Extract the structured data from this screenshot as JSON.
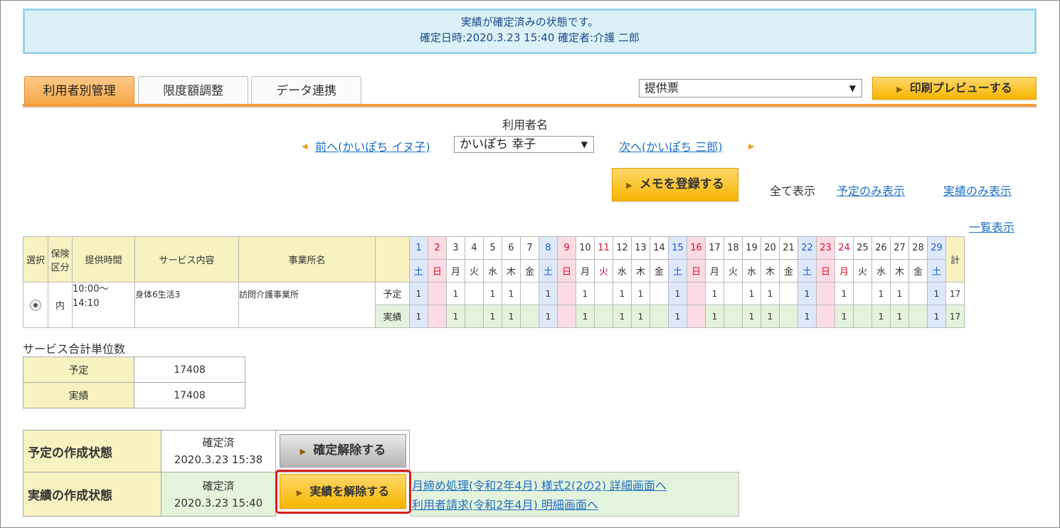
{
  "notice": {
    "line1": "実績が確定済みの状態です。",
    "line2": "確定日時:2020.3.23 15:40 確定者:介護 二郎"
  },
  "tabs": [
    "利用者別管理",
    "限度額調整",
    "データ連携"
  ],
  "report_select": {
    "value": "提供票"
  },
  "print_button": "印刷プレビューする",
  "user_nav": {
    "label": "利用者名",
    "prev": "前へ(かいぽち イヌ子)",
    "current": "かいぽち 幸子",
    "next": "次へ(かいぽち 三郎)"
  },
  "memo_button": "メモを登録する",
  "view_filters": {
    "all": "全て表示",
    "planned_only": "予定のみ表示",
    "actual_only": "実績のみ表示"
  },
  "list_view_link": "一覧表示",
  "table": {
    "headers": {
      "select": "選択",
      "insurance": "保険区分",
      "time": "提供時間",
      "service": "サービス内容",
      "office": "事業所名",
      "total": "計"
    },
    "days": [
      {
        "d": "1",
        "w": "土",
        "t": "sat"
      },
      {
        "d": "2",
        "w": "日",
        "t": "sun"
      },
      {
        "d": "3",
        "w": "月",
        "t": "wk"
      },
      {
        "d": "4",
        "w": "火",
        "t": "wk"
      },
      {
        "d": "5",
        "w": "水",
        "t": "wk"
      },
      {
        "d": "6",
        "w": "木",
        "t": "wk"
      },
      {
        "d": "7",
        "w": "金",
        "t": "wk"
      },
      {
        "d": "8",
        "w": "土",
        "t": "sat"
      },
      {
        "d": "9",
        "w": "日",
        "t": "sun"
      },
      {
        "d": "10",
        "w": "月",
        "t": "wk"
      },
      {
        "d": "11",
        "w": "火",
        "t": "hol"
      },
      {
        "d": "12",
        "w": "水",
        "t": "wk"
      },
      {
        "d": "13",
        "w": "木",
        "t": "wk"
      },
      {
        "d": "14",
        "w": "金",
        "t": "wk"
      },
      {
        "d": "15",
        "w": "土",
        "t": "sat"
      },
      {
        "d": "16",
        "w": "日",
        "t": "sun"
      },
      {
        "d": "17",
        "w": "月",
        "t": "wk"
      },
      {
        "d": "18",
        "w": "火",
        "t": "wk"
      },
      {
        "d": "19",
        "w": "水",
        "t": "wk"
      },
      {
        "d": "20",
        "w": "木",
        "t": "wk"
      },
      {
        "d": "21",
        "w": "金",
        "t": "wk"
      },
      {
        "d": "22",
        "w": "土",
        "t": "sat"
      },
      {
        "d": "23",
        "w": "日",
        "t": "sun"
      },
      {
        "d": "24",
        "w": "月",
        "t": "hol"
      },
      {
        "d": "25",
        "w": "火",
        "t": "wk"
      },
      {
        "d": "26",
        "w": "水",
        "t": "wk"
      },
      {
        "d": "27",
        "w": "木",
        "t": "wk"
      },
      {
        "d": "28",
        "w": "金",
        "t": "wk"
      },
      {
        "d": "29",
        "w": "土",
        "t": "sat"
      }
    ],
    "row": {
      "insurance": "内",
      "time": "10:00〜\n14:10",
      "service": "身体6生活3",
      "office": "訪問介護事業所",
      "planned_label": "予定",
      "actual_label": "実績",
      "planned": [
        "1",
        "",
        "1",
        "",
        "1",
        "1",
        "",
        "1",
        "",
        "1",
        "",
        "1",
        "1",
        "",
        "1",
        "",
        "1",
        "",
        "1",
        "1",
        "",
        "1",
        "",
        "1",
        "",
        "1",
        "1",
        "",
        "1"
      ],
      "actual": [
        "1",
        "",
        "1",
        "",
        "1",
        "1",
        "",
        "1",
        "",
        "1",
        "",
        "1",
        "1",
        "",
        "1",
        "",
        "1",
        "",
        "1",
        "1",
        "",
        "1",
        "",
        "1",
        "",
        "1",
        "1",
        "",
        "1"
      ],
      "planned_total": "17",
      "actual_total": "17"
    }
  },
  "summary": {
    "title": "サービス合計単位数",
    "rows": [
      {
        "label": "予定",
        "value": "17408"
      },
      {
        "label": "実績",
        "value": "17408"
      }
    ]
  },
  "status": {
    "planned_label": "予定の作成状態",
    "planned_state": "確定済",
    "planned_date": "2020.3.23 15:38",
    "planned_button": "確定解除する",
    "actual_label": "実績の作成状態",
    "actual_state": "確定済",
    "actual_date": "2020.3.23 15:40",
    "actual_button": "実績を解除する",
    "link1": "月締め処理(令和2年4月) 様式2(2の2) 詳細画面へ",
    "link2": "利用者請求(令和2年4月) 明細画面へ"
  }
}
